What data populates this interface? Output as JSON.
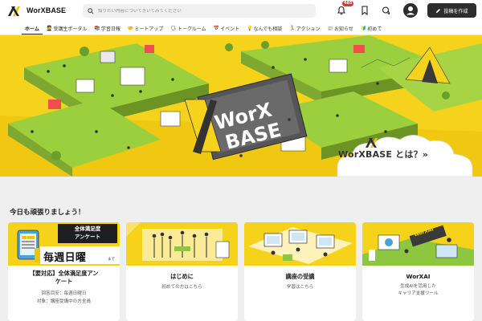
{
  "app": {
    "logo_text": "WorXBASE",
    "search_placeholder": "知りたい内容についてきいてみてください",
    "notification_count": "485",
    "post_button_label": "投稿を作成"
  },
  "nav": {
    "items": [
      {
        "emoji": "",
        "label": "ホーム",
        "active": true
      },
      {
        "emoji": "🧑‍🎓",
        "label": "受講生ポータル"
      },
      {
        "emoji": "📚",
        "label": "学習日報"
      },
      {
        "emoji": "🤝",
        "label": "ミートアップ"
      },
      {
        "emoji": "🗣",
        "label": "トークルーム"
      },
      {
        "emoji": "📅",
        "label": "イベント"
      },
      {
        "emoji": "💡",
        "label": "なんでも相談"
      },
      {
        "emoji": "🏃",
        "label": "アクション"
      },
      {
        "emoji": "📰",
        "label": "お知らせ"
      },
      {
        "emoji": "🔰",
        "label": "初めて"
      }
    ]
  },
  "hero": {
    "sign_text_1": "WorX",
    "sign_text_2": "BASE",
    "cta_label": "WorXBASE とは？»"
  },
  "main": {
    "greeting": "今日も頑張りましょう！",
    "cards": [
      {
        "img_head": "全体満足度",
        "img_head2": "アンケート",
        "img_big": "毎週日曜",
        "img_tail": "まで",
        "title_1": "【要対応】全体満足度アン",
        "title_2": "ケート",
        "sub_1": "回答目安：毎週日曜日",
        "sub_2": "対象：講座受講中の方全員"
      },
      {
        "title_1": "はじめに",
        "sub_1": "初めての方はこちら"
      },
      {
        "title_1": "講座の受講",
        "sub_1": "学習はこちら"
      },
      {
        "img_sign": "WorXAI",
        "title_1": "WorXAI",
        "sub_1": "生成AIを活用した",
        "sub_2": "キャリア支援ツール"
      }
    ]
  },
  "colors": {
    "brand_yellow": "#f5d21c",
    "dark": "#2d2d2d",
    "badge_red": "#e0343a",
    "grass": "#8dc63f"
  }
}
